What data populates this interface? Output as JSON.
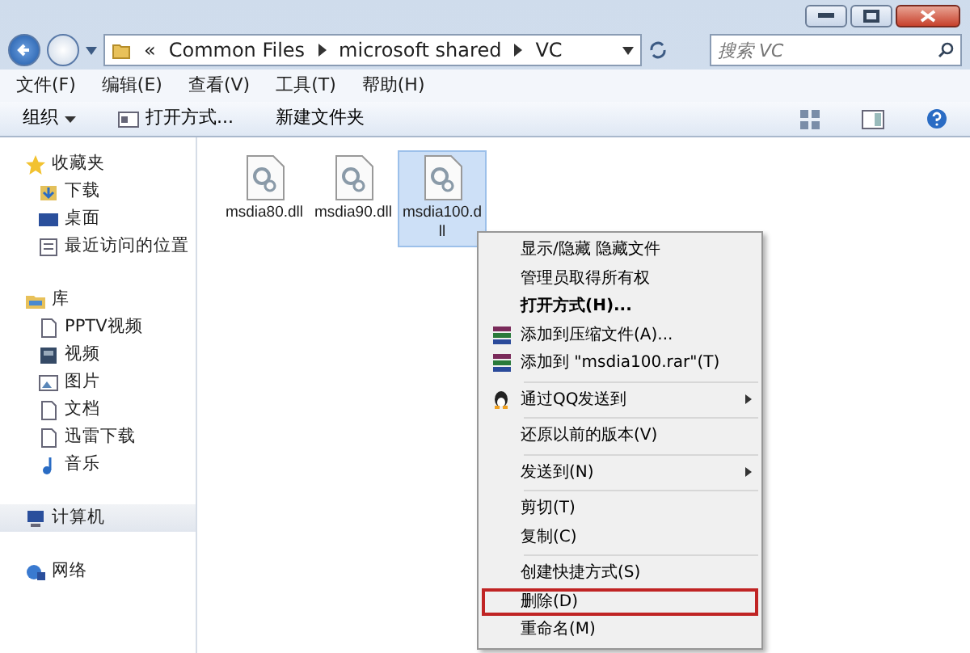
{
  "address": {
    "overflow": "«",
    "segments": [
      "Common Files",
      "microsoft shared",
      "VC"
    ]
  },
  "search": {
    "placeholder": "搜索 VC"
  },
  "menu_bar": [
    "文件(F)",
    "编辑(E)",
    "查看(V)",
    "工具(T)",
    "帮助(H)"
  ],
  "toolbar": [
    {
      "label": "组织",
      "kind": "dropdown"
    },
    {
      "label": "打开方式...",
      "kind": "icon"
    },
    {
      "label": "新建文件夹",
      "kind": "plain"
    }
  ],
  "sidebar": [
    {
      "label": "收藏夹",
      "selected": false,
      "children": [
        {
          "label": "下载",
          "selected": false
        },
        {
          "label": "桌面",
          "selected": false
        },
        {
          "label": "最近访问的位置",
          "selected": false
        }
      ]
    },
    {
      "label": "库",
      "selected": false,
      "children": [
        {
          "label": "PPTV视频",
          "selected": false
        },
        {
          "label": "视频",
          "selected": false
        },
        {
          "label": "图片",
          "selected": false
        },
        {
          "label": "文档",
          "selected": false
        },
        {
          "label": "迅雷下载",
          "selected": false
        },
        {
          "label": "音乐",
          "selected": false
        }
      ]
    },
    {
      "label": "计算机",
      "selected": true
    },
    {
      "label": "网络",
      "selected": false
    }
  ],
  "files": [
    {
      "name": "msdia80.dll",
      "selected": false
    },
    {
      "name": "msdia90.dll",
      "selected": false
    },
    {
      "name": "msdia100.dll",
      "selected": true
    }
  ],
  "context_menu": [
    {
      "kind": "item",
      "label": "显示/隐藏 隐藏文件",
      "bold": false,
      "submenu": false,
      "highlighted": false
    },
    {
      "kind": "item",
      "label": "管理员取得所有权",
      "bold": false,
      "submenu": false,
      "highlighted": false
    },
    {
      "kind": "item",
      "label": "打开方式(H)...",
      "bold": true,
      "submenu": false,
      "highlighted": false
    },
    {
      "kind": "archive",
      "label": "添加到压缩文件(A)...",
      "bold": false,
      "submenu": false,
      "highlighted": false
    },
    {
      "kind": "archive",
      "label": "添加到 \"msdia100.rar\"(T)",
      "bold": false,
      "submenu": false,
      "highlighted": false
    },
    {
      "kind": "separator"
    },
    {
      "kind": "qq",
      "label": "通过QQ发送到",
      "bold": false,
      "submenu": true,
      "highlighted": false
    },
    {
      "kind": "separator"
    },
    {
      "kind": "item",
      "label": "还原以前的版本(V)",
      "bold": false,
      "submenu": false,
      "highlighted": false
    },
    {
      "kind": "separator"
    },
    {
      "kind": "item",
      "label": "发送到(N)",
      "bold": false,
      "submenu": true,
      "highlighted": false
    },
    {
      "kind": "separator"
    },
    {
      "kind": "item",
      "label": "剪切(T)",
      "bold": false,
      "submenu": false,
      "highlighted": false
    },
    {
      "kind": "item",
      "label": "复制(C)",
      "bold": false,
      "submenu": false,
      "highlighted": false
    },
    {
      "kind": "separator"
    },
    {
      "kind": "item",
      "label": "创建快捷方式(S)",
      "bold": false,
      "submenu": false,
      "highlighted": false
    },
    {
      "kind": "item",
      "label": "删除(D)",
      "bold": false,
      "submenu": false,
      "highlighted": true
    },
    {
      "kind": "item",
      "label": "重命名(M)",
      "bold": false,
      "submenu": false,
      "highlighted": false
    }
  ]
}
